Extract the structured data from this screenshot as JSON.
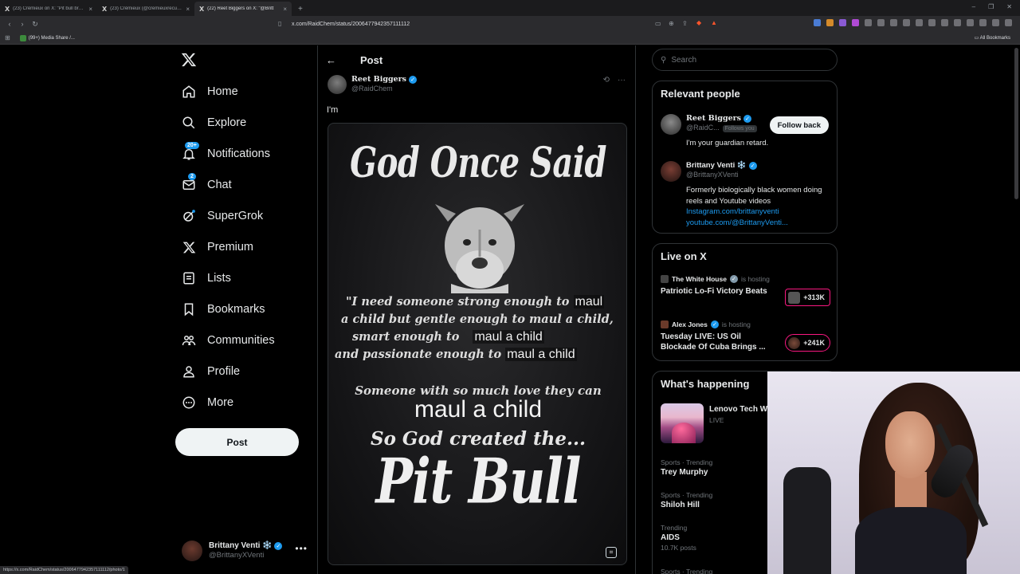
{
  "browser": {
    "tabs": [
      {
        "title": "(23) Crémieux on X: \"Pit bull breeder"
      },
      {
        "title": "(23) Crémieux (@cremieuxrecueil) / X"
      },
      {
        "title": "(22) Reet Biggers on X: \"@Britt"
      }
    ],
    "url": "x.com/RaidChem/status/2006477942357111112",
    "bookmark": "(99+) Media Share /...",
    "all_bookmarks": "All Bookmarks",
    "status_url": "https://x.com/RaidChem/status/2006477942357111112/photo/1"
  },
  "nav": {
    "items": [
      {
        "label": "Home",
        "icon": "home-icon"
      },
      {
        "label": "Explore",
        "icon": "search-icon"
      },
      {
        "label": "Notifications",
        "icon": "bell-icon",
        "badge": "20+"
      },
      {
        "label": "Chat",
        "icon": "mail-icon",
        "badge": "2"
      },
      {
        "label": "SuperGrok",
        "icon": "grok-icon"
      },
      {
        "label": "Premium",
        "icon": "x-logo-icon"
      },
      {
        "label": "Lists",
        "icon": "list-icon"
      },
      {
        "label": "Bookmarks",
        "icon": "bookmark-icon"
      },
      {
        "label": "Communities",
        "icon": "communities-icon"
      },
      {
        "label": "Profile",
        "icon": "person-icon"
      },
      {
        "label": "More",
        "icon": "more-circle-icon"
      }
    ],
    "post_button": "Post",
    "account": {
      "name": "Brittany Venti ❄️",
      "handle": "@BrittanyXVenti"
    }
  },
  "post": {
    "header": "Post",
    "author_name": "Reet Biggers",
    "author_handle": "@RaidChem",
    "text": "I'm",
    "meme": {
      "line1": "God Once Said",
      "quote": [
        {
          "pre": "\"I need someone strong enough to",
          "overlay": "maul"
        },
        {
          "pre": "a child but gentle enough to maul a child,",
          "overlay": ""
        },
        {
          "pre": "smart enough to",
          "overlay": "maul a child"
        },
        {
          "pre": "and passionate enough to",
          "overlay": "maul a child"
        }
      ],
      "line4": "Someone with so much love they can",
      "line5": "maul a child",
      "line6": "So God created the...",
      "line7": "Pit Bull"
    }
  },
  "search": {
    "placeholder": "Search"
  },
  "relevant": {
    "title": "Relevant people",
    "people": [
      {
        "name": "Reet Biggers",
        "handle": "@RaidC...",
        "follows_you": "Follows you",
        "bio": "I'm your guardian retard."
      },
      {
        "name": "Brittany Venti ❄️",
        "handle": "@BrittanyXVenti",
        "bio": "Formerly biologically black women doing reels and Youtube videos",
        "links": [
          "Instagram.com/brittanyventi",
          "youtube.com/@BrittanyVenti..."
        ]
      }
    ],
    "follow_back": "Follow back"
  },
  "live": {
    "title": "Live on X",
    "items": [
      {
        "host": "The White House",
        "hosting": "is hosting",
        "title": "Patriotic Lo-Fi Victory Beats",
        "count": "+313K"
      },
      {
        "host": "Alex Jones",
        "hosting": "is hosting",
        "title": "Tuesday LIVE: US Oil Blockade Of Cuba Brings ...",
        "count": "+241K"
      }
    ]
  },
  "happening": {
    "title": "What's happening",
    "feature": {
      "title": "Lenovo Tech Wo",
      "status": "LIVE"
    },
    "trends": [
      {
        "category": "Sports · Trending",
        "topic": "Trey Murphy",
        "count": ""
      },
      {
        "category": "Sports · Trending",
        "topic": "Shiloh Hill",
        "count": ""
      },
      {
        "category": "Trending",
        "topic": "AIDS",
        "count": "10.7K posts"
      },
      {
        "category": "Sports · Trending",
        "topic": "",
        "count": ""
      }
    ]
  },
  "colors": {
    "accent": "#1d9bf0",
    "live_pink": "#f91880",
    "bg": "#000000",
    "border": "#2f3336"
  }
}
